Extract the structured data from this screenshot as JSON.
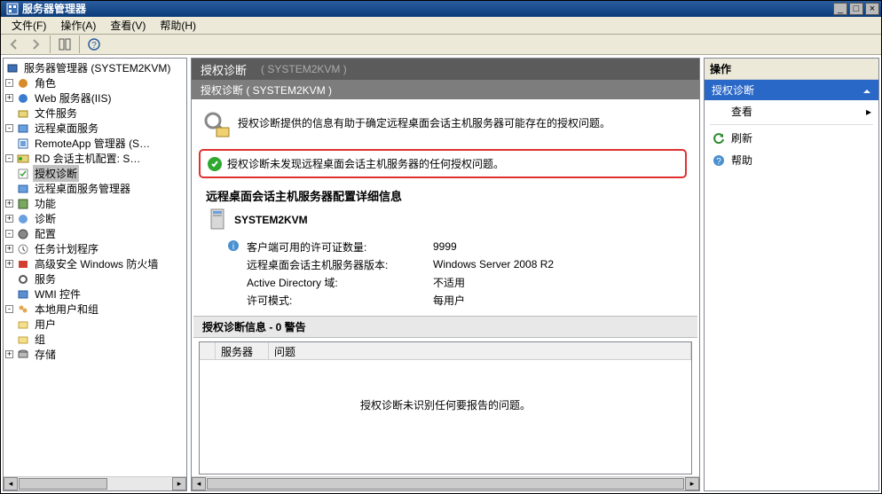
{
  "window": {
    "title": "服务器管理器"
  },
  "menu": {
    "file": "文件(F)",
    "action": "操作(A)",
    "view": "查看(V)",
    "help": "帮助(H)"
  },
  "tree": {
    "root": "服务器管理器",
    "root_suffix": "(SYSTEM2KVM)",
    "roles": "角色",
    "web": "Web 服务器(IIS)",
    "fileservice": "文件服务",
    "rds": "远程桌面服务",
    "remoteapp": "RemoteApp 管理器",
    "remoteapp_suffix": "(S…",
    "rdsession": "RD 会话主机配置:",
    "rdsession_suffix": "S…",
    "licdiag": "授权诊断",
    "rdslicsvc": "远程桌面服务管理器",
    "features": "功能",
    "diag": "诊断",
    "config": "配置",
    "tasksched": "任务计划程序",
    "firewall": "高级安全 Windows 防火墙",
    "services": "服务",
    "wmi": "WMI 控件",
    "localusers": "本地用户和组",
    "users": "用户",
    "groups": "组",
    "storage": "存储"
  },
  "main": {
    "header_title": "授权诊断",
    "header_sub": "( SYSTEM2KVM )",
    "subheader": "授权诊断 ( SYSTEM2KVM )",
    "intro_text": "授权诊断提供的信息有助于确定远程桌面会话主机服务器可能存在的授权问题。",
    "ok_text": "授权诊断未发现远程桌面会话主机服务器的任何授权问题。",
    "section_title": "远程桌面会话主机服务器配置详细信息",
    "server_name": "SYSTEM2KVM",
    "kv": {
      "k1": "客户端可用的许可证数量:",
      "v1": "9999",
      "k2": "远程桌面会话主机服务器版本:",
      "v2": "Windows Server 2008 R2",
      "k3": "Active Directory 域:",
      "v3": "不适用",
      "k4": "许可模式:",
      "v4": "每用户"
    },
    "diag_header": "授权诊断信息 - 0 警告",
    "col_server": "服务器",
    "col_issue": "问题",
    "empty_text": "授权诊断未识别任何要报告的问题。"
  },
  "actions": {
    "header": "操作",
    "subheader": "授权诊断",
    "view": "查看",
    "refresh": "刷新",
    "help": "帮助"
  }
}
